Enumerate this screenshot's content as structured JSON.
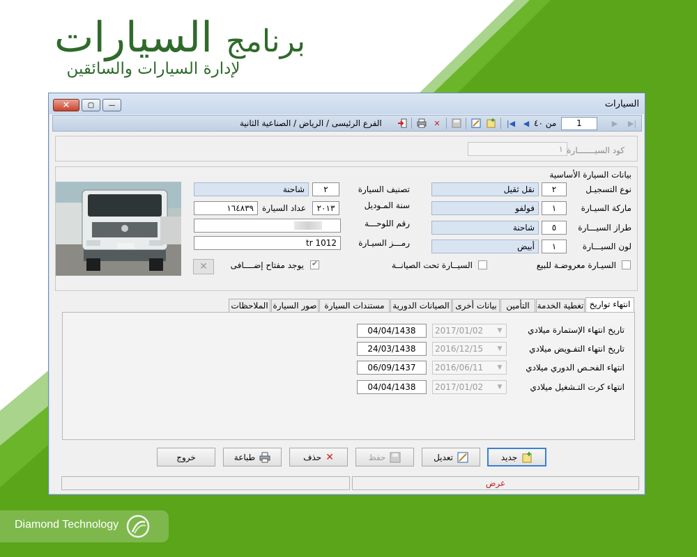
{
  "hero": {
    "title_main": "السيارات",
    "title_prefix": "برنامج",
    "subtitle": "لإدارة السيارات والسائقين"
  },
  "brand": {
    "name": "Diamond Technology"
  },
  "colors": {
    "green_dark": "#2f6a2a",
    "green_bright": "#5aa51a",
    "window_border": "#6a8db5",
    "selected_field": "#d9e4f2",
    "mode_text": "#c22020"
  },
  "window": {
    "title": "السيارات",
    "toolbar": {
      "record_no": "1",
      "of_label": "من ٤٠",
      "branch_path": "الفرع الرئيسى / الرياض / الصناعية الثانية",
      "icons": [
        "last-icon",
        "next-icon",
        "first-icon",
        "previous-icon",
        "new-icon",
        "edit-icon",
        "save-icon",
        "delete-icon",
        "print-icon",
        "exit-icon"
      ]
    },
    "code": {
      "label": "كود السيـــــــارة",
      "value": "١"
    },
    "basic": {
      "section_title": "بيانات السيارة الأساسية",
      "reg_type": {
        "label": "نوع التسجيـل",
        "code": "٢",
        "name": "نقل ثقيل"
      },
      "make": {
        "label": "ماركة السيـارة",
        "code": "١",
        "name": "فولفو"
      },
      "model": {
        "label": "طراز السيـــارة",
        "code": "٥",
        "name": "شاحنة"
      },
      "color": {
        "label": "لون السيـــارة",
        "code": "١",
        "name": "أبيض"
      },
      "class": {
        "label": "تصنيف السيارة",
        "code": "٢",
        "name": "شاحنة"
      },
      "year": {
        "label": "سنة المـوديل",
        "value": "٢٠١٣"
      },
      "odometer": {
        "label": "عداد السيارة",
        "value": "١٦٤٨٣٩"
      },
      "plate": {
        "label": "رقم اللوحـــة",
        "value": ""
      },
      "car_code": {
        "label": "رمـــز السيـارة",
        "value": "tr 1012"
      },
      "for_sale": {
        "label": "السيـارة معروضـة للبيع",
        "checked": false
      },
      "maintenance": {
        "label": "السيــارة تحت الصيانــة",
        "checked": false
      },
      "spare_key": {
        "label": "يوجد مفتاح إضــــافى",
        "checked": true
      }
    },
    "tabs": [
      {
        "label": "انتهاء تواريخ",
        "active": true
      },
      {
        "label": "تغطية الخدمة"
      },
      {
        "label": "التأمين"
      },
      {
        "label": "بيانات أخرى"
      },
      {
        "label": "الصيانات الدورية"
      },
      {
        "label": "مستندات السيارة"
      },
      {
        "label": "صور السيارة"
      },
      {
        "label": "الملاحظات"
      }
    ],
    "dates": [
      {
        "label": "تاريخ انتهاء الإستمارة  ميلادي",
        "gregorian": "2017/01/02",
        "hijri": "04/04/1438"
      },
      {
        "label": "تاريخ انتهاء التفـويض ميلادي",
        "gregorian": "2016/12/15",
        "hijri": "24/03/1438"
      },
      {
        "label": "انتهاء الفحـص الدوري ميلادي",
        "gregorian": "2016/06/11",
        "hijri": "06/09/1437"
      },
      {
        "label": "انتهاء كرت  التـشغيل  ميلادي",
        "gregorian": "2017/01/02",
        "hijri": "04/04/1438"
      }
    ],
    "buttons": {
      "new": "جديد",
      "edit": "تعديل",
      "save": "حفظ",
      "delete": "حذف",
      "print": "طباعة",
      "exit": "خروج"
    },
    "status": {
      "mode": "عرض",
      "left": ""
    }
  }
}
